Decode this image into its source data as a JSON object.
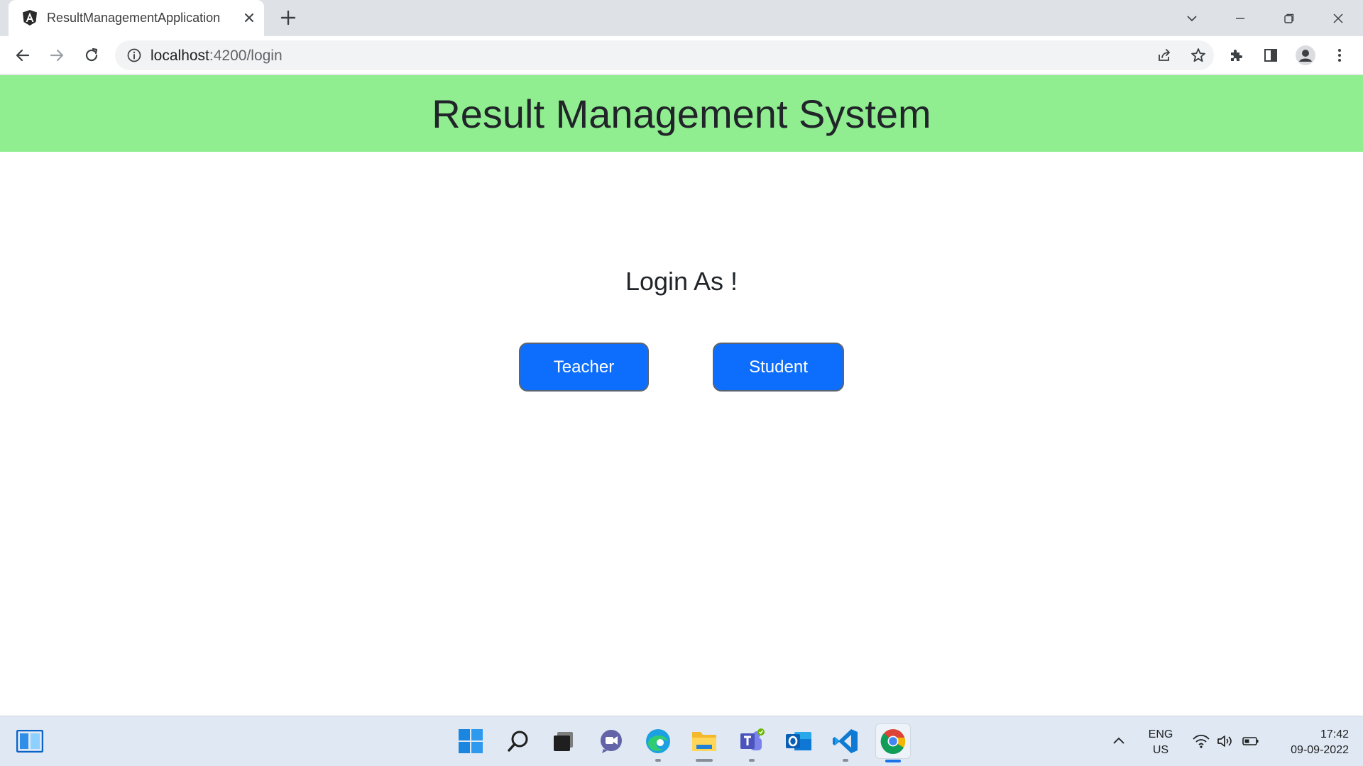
{
  "browser": {
    "tab_title": "ResultManagementApplication",
    "url_host": "localhost",
    "url_rest": ":4200/login"
  },
  "page": {
    "app_title": "Result Management System",
    "login_heading": "Login As !",
    "buttons": {
      "teacher": "Teacher",
      "student": "Student"
    }
  },
  "taskbar": {
    "lang_top": "ENG",
    "lang_bottom": "US",
    "time": "17:42",
    "date": "09-09-2022"
  },
  "colors": {
    "header_band": "#90ee90",
    "primary_button": "#0d6efd",
    "tab_strip": "#dee1e6"
  },
  "icons": {
    "tab": [
      "angular-logo-icon",
      "close-icon",
      "plus-icon"
    ],
    "window": [
      "chevron-down-icon",
      "minimize-icon",
      "restore-icon",
      "close-window-icon"
    ],
    "toolbar": [
      "back-arrow-icon",
      "forward-arrow-icon",
      "reload-icon",
      "info-icon",
      "share-icon",
      "star-icon",
      "puzzle-icon",
      "side-panel-icon",
      "profile-icon",
      "more-vert-icon"
    ],
    "taskbar": [
      "widgets-icon",
      "windows-start-icon",
      "search-icon",
      "task-view-icon",
      "chat-icon",
      "edge-icon",
      "file-explorer-icon",
      "teams-icon",
      "outlook-icon",
      "vscode-icon",
      "chrome-icon",
      "chevron-up-icon",
      "wifi-icon",
      "volume-icon",
      "battery-icon"
    ]
  }
}
